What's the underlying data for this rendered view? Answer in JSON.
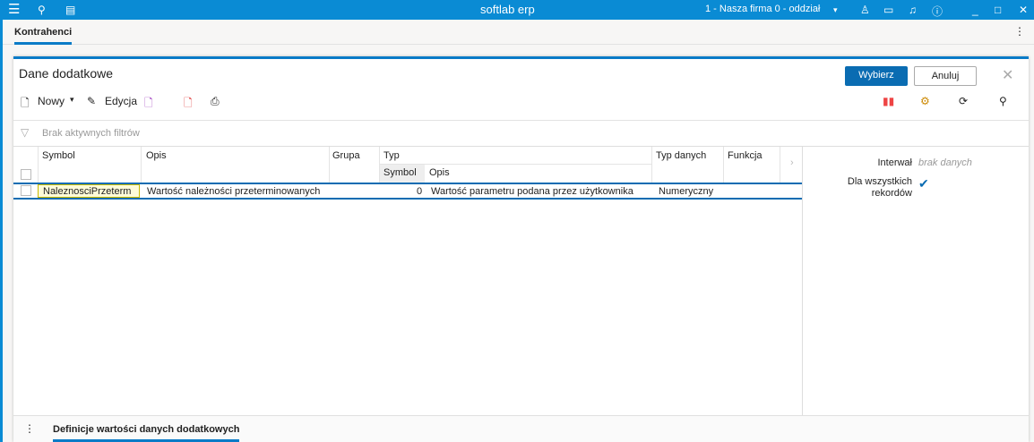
{
  "app_title": "softlab erp",
  "company": "1 - Nasza firma 0 - oddział",
  "tab": "Kontrahenci",
  "dialog": {
    "title": "Dane dodatkowe",
    "select": "Wybierz",
    "cancel": "Anuluj"
  },
  "toolbar": {
    "new": "Nowy",
    "edit": "Edycja"
  },
  "filter": "Brak aktywnych filtrów",
  "columns": {
    "symbol": "Symbol",
    "opis": "Opis",
    "grupa": "Grupa",
    "typ": "Typ",
    "typ_symbol": "Symbol",
    "typ_opis": "Opis",
    "typ_danych": "Typ danych",
    "funkcja": "Funkcja"
  },
  "rows": [
    {
      "symbol": "NaleznosciPrzeterm",
      "opis": "Wartość należności przeterminowanych",
      "grupa": "",
      "typ_symbol": "0",
      "typ_opis": "Wartość parametru podana przez użytkownika",
      "typ_danych": "Numeryczny",
      "funkcja": ""
    }
  ],
  "details": {
    "interval_label": "Interwał",
    "interval_value": "brak danych",
    "all_label": "Dla wszystkich rekordów"
  },
  "bottom_tab": "Definicje wartości danych dodatkowych"
}
